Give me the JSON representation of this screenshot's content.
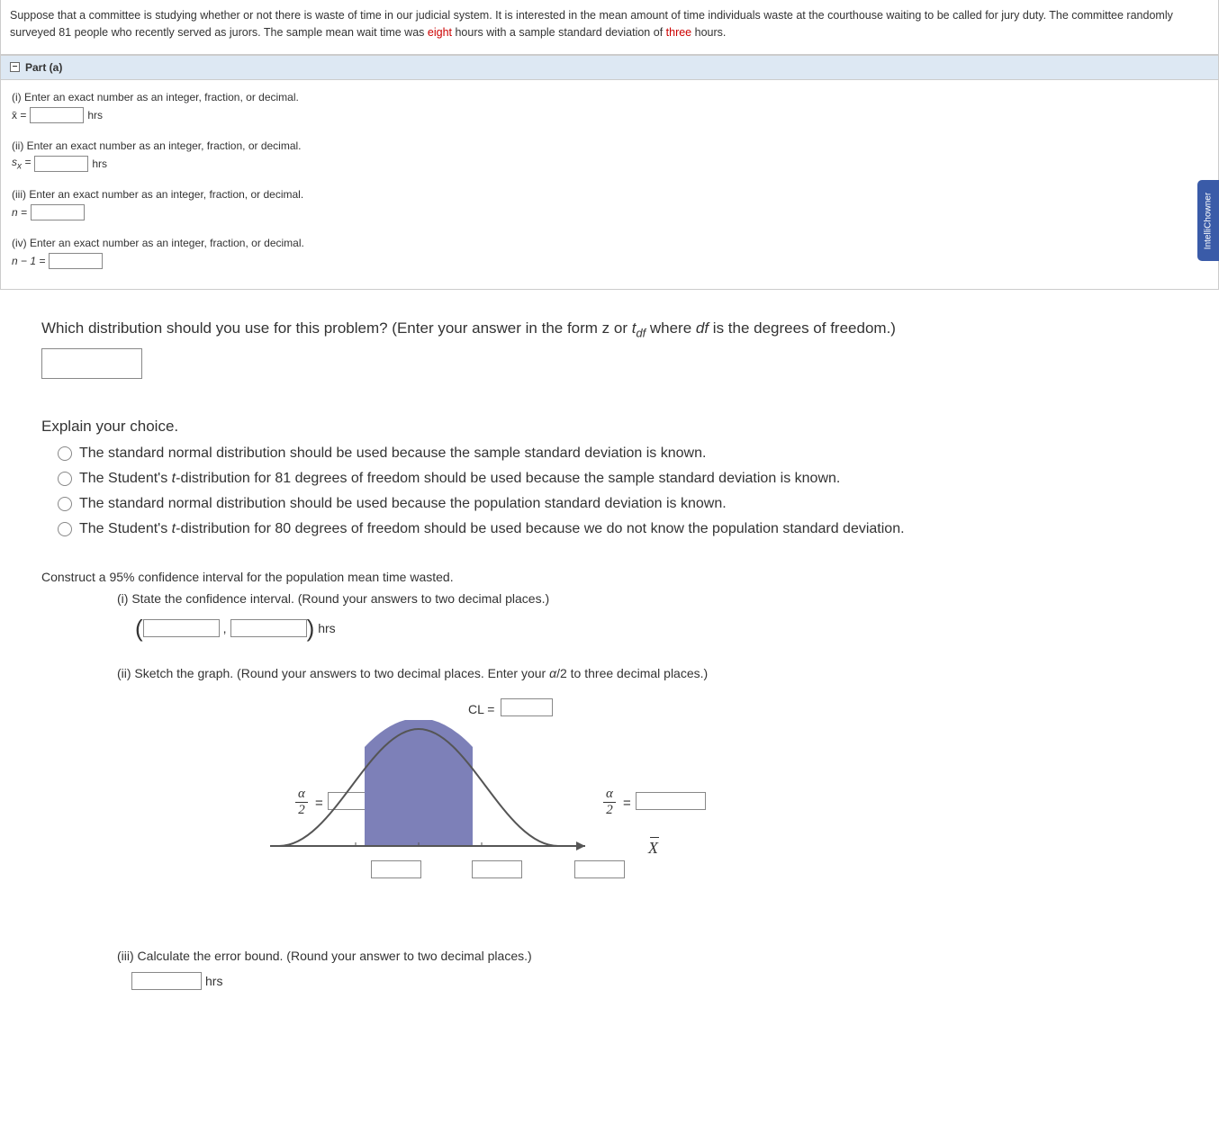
{
  "prompt": {
    "t1": "Suppose that a committee is studying whether or not there is waste of time in our judicial system. It is interested in the mean amount of time individuals waste at the courthouse waiting to be called for jury duty. The committee randomly surveyed 81 people who recently served as jurors. The sample mean wait time was ",
    "r1": "eight",
    "t2": " hours with a sample standard deviation of ",
    "r2": "three",
    "t3": " hours."
  },
  "partA": {
    "header": "Part (a)",
    "instr": "Enter an exact number as an integer, fraction, or decimal.",
    "i": {
      "prefix": "(i) ",
      "var": "x̄ =",
      "unit": "hrs"
    },
    "ii": {
      "prefix": "(ii) ",
      "var": "sₓ =",
      "unit": "hrs"
    },
    "iii": {
      "prefix": "(iii) ",
      "var": "n ="
    },
    "iv": {
      "prefix": "(iv) ",
      "var": "n − 1 ="
    }
  },
  "dist": {
    "q": "Which distribution should you use for this problem? (Enter your answer in the form z or ",
    "tdf": "t",
    "sub": "df",
    "q2": " where ",
    "df_ital": "df",
    "q3": " is the degrees of freedom.)"
  },
  "explain": {
    "title": "Explain your choice.",
    "opts": [
      "The standard normal distribution should be used because the sample standard deviation is known.",
      "The Student's t-distribution for 81 degrees of freedom should be used because the sample standard deviation is known.",
      "The standard normal distribution should be used because the population standard deviation is known.",
      "The Student's t-distribution for 80 degrees of freedom should be used because we do not know the population standard deviation."
    ],
    "ital_t": "t"
  },
  "ci": {
    "title": "Construct a 95% confidence interval for the population mean time wasted.",
    "i": "(i) State the confidence interval. (Round your answers to two decimal places.)",
    "hrs": "hrs",
    "ii": "(ii) Sketch the graph. (Round your answers to two decimal places. Enter your α/2 to three decimal places.)",
    "cl": "CL =",
    "alpha": "α",
    "two": "2",
    "eq": "=",
    "xbar": "X",
    "iii": "(iii) Calculate the error bound. (Round your answer to two decimal places.)"
  },
  "sideTab": "IntelliChowner"
}
